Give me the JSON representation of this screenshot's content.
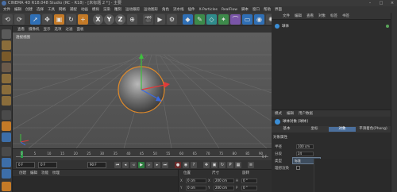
{
  "window": {
    "title": "CINEMA 4D R18.048 Studio (RC - R18) - [未标题 2 *] - 主要"
  },
  "menubar": {
    "items": [
      "文件",
      "编辑",
      "创建",
      "选择",
      "工具",
      "网格",
      "捕捉",
      "动画",
      "模拟",
      "渲染",
      "雕刻",
      "运动跟踪",
      "运动图形",
      "角色",
      "流水线",
      "插件",
      "X-Particles",
      "RealFlow",
      "脚本",
      "窗口",
      "帮助",
      "界面"
    ]
  },
  "toolbar": {
    "undo_label": "⟲",
    "axis_x": "X",
    "axis_y": "Y",
    "axis_z": "Z"
  },
  "viewport": {
    "menu": [
      "查看",
      "摄像机",
      "显示",
      "选项",
      "过滤",
      "面板"
    ],
    "label": "透视视图"
  },
  "timeline": {
    "ticks": [
      "0",
      "5",
      "10",
      "15",
      "20",
      "25",
      "30",
      "35",
      "40",
      "45",
      "50",
      "55",
      "60",
      "65",
      "70",
      "75",
      "80",
      "85",
      "90"
    ],
    "end_frame": "0 F",
    "current_frame": "0 F",
    "start_field": "0 F",
    "end_field": "90 F",
    "max_field": "90 F"
  },
  "material_manager": {
    "menu": [
      "创建",
      "编辑",
      "功能",
      "纹理"
    ]
  },
  "coordinates": {
    "headers": [
      "位置",
      "尺寸",
      "旋转"
    ],
    "rows": [
      {
        "axis": "X",
        "pos": "0 cm",
        "size": "200 cm",
        "rot_label": "H",
        "rot": "0 °"
      },
      {
        "axis": "Y",
        "pos": "0 cm",
        "size": "200 cm",
        "rot_label": "P",
        "rot": "0 °"
      }
    ]
  },
  "object_manager": {
    "tabs": [
      "文件",
      "编辑",
      "查看",
      "对象",
      "标签",
      "书签"
    ],
    "objects": [
      {
        "name": "球体"
      }
    ]
  },
  "attributes": {
    "tabs": [
      "模式",
      "编辑",
      "用户数据"
    ],
    "title": "球体对象 [球体]",
    "subtabs": [
      "基本",
      "坐标",
      "对象",
      "平滑着色(Phong)"
    ],
    "active_subtab": "对象",
    "section": "对象属性",
    "props": [
      {
        "label": "半径",
        "value": "100 cm"
      },
      {
        "label": "分段",
        "value": "24"
      },
      {
        "label": "类型",
        "value": "标准"
      },
      {
        "label": "理想渲染",
        "value": ""
      }
    ],
    "dropdown_value": "标准"
  }
}
